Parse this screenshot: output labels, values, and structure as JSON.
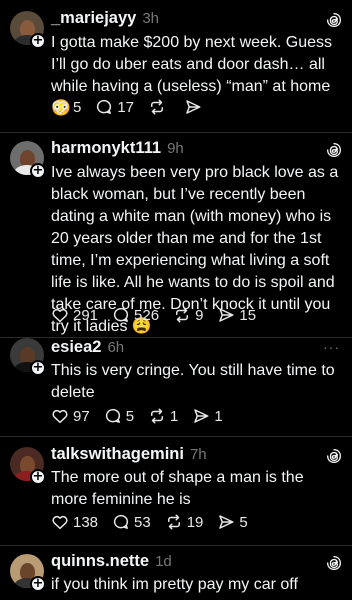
{
  "posts": [
    {
      "username": "_mariejayy",
      "time": "3h",
      "text": "I gotta make $200 by next week. Guess I’ll go do uber eats and door dash… all while having a (useless) “man” at home 😳",
      "likes": "5",
      "replies": "17",
      "reposts": "",
      "shares": "",
      "top_icon": "threads-logo-icon"
    },
    {
      "username": "harmonykt111",
      "time": "9h",
      "text": "Ive always been very pro black love as a black woman, but I’ve recently been dating a white man (with money) who is 20 years older than me and for the 1st time, I’m experiencing what living a soft life is like. All he wants to do is spoil and take care of me. Don’t knock it until you try it ladies 😩",
      "likes": "291",
      "replies": "526",
      "reposts": "9",
      "shares": "15",
      "top_icon": "threads-logo-icon"
    },
    {
      "username": "esiea2",
      "time": "6h",
      "text": "This is very cringe. You still have time to delete",
      "likes": "97",
      "replies": "5",
      "reposts": "1",
      "shares": "1",
      "top_icon": "more-icon",
      "more": "···"
    },
    {
      "username": "talkswithagemini",
      "time": "7h",
      "text": "The more out of shape a man is the more feminine he is",
      "likes": "138",
      "replies": "53",
      "reposts": "19",
      "shares": "5",
      "top_icon": "threads-logo-icon"
    },
    {
      "username": "quinns.nette",
      "time": "1d",
      "text": "if you think im pretty pay my car off",
      "top_icon": "threads-logo-icon"
    }
  ],
  "plus_glyph": "+",
  "colors": {
    "background": "#000000",
    "text": "#f3f5f7",
    "muted": "#777777",
    "divider": "#2b2b2b"
  }
}
